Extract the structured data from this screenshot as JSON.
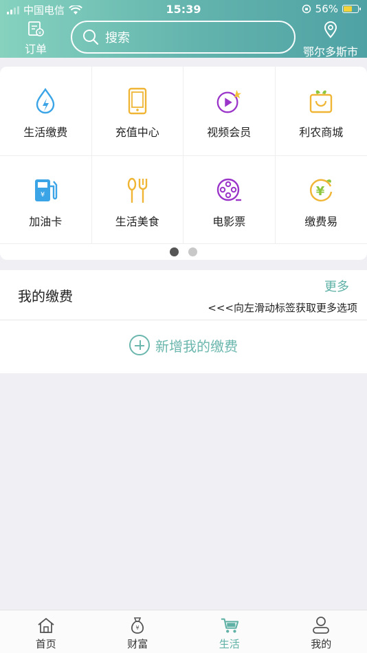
{
  "status": {
    "carrier": "中国电信",
    "time": "15:39",
    "battery": "56%",
    "battery_level": 0.56
  },
  "header": {
    "order_label": "订单",
    "search_placeholder": "搜索",
    "location": "鄂尔多斯市"
  },
  "services": [
    {
      "label": "生活缴费",
      "icon": "water-drop-bolt-icon"
    },
    {
      "label": "充值中心",
      "icon": "phone-icon"
    },
    {
      "label": "视频会员",
      "icon": "video-play-icon"
    },
    {
      "label": "利农商城",
      "icon": "shopping-basket-icon"
    },
    {
      "label": "加油卡",
      "icon": "fuel-pump-icon"
    },
    {
      "label": "生活美食",
      "icon": "spoon-fork-icon"
    },
    {
      "label": "电影票",
      "icon": "film-reel-icon"
    },
    {
      "label": "缴费易",
      "icon": "yuan-coin-icon"
    }
  ],
  "pager": {
    "pages": 2,
    "active": 0
  },
  "my_payment": {
    "title": "我的缴费",
    "more": "更多",
    "hint": "<<<向左滑动标签获取更多选项",
    "add_label": "新增我的缴费"
  },
  "tabs": [
    {
      "label": "首页",
      "icon": "home-icon"
    },
    {
      "label": "财富",
      "icon": "money-bag-icon"
    },
    {
      "label": "生活",
      "icon": "cart-icon",
      "active": true
    },
    {
      "label": "我的",
      "icon": "user-icon"
    }
  ],
  "colors": {
    "accent": "#5fb1a6",
    "header_start": "#86d2bf",
    "header_end": "#4fa2a4"
  }
}
